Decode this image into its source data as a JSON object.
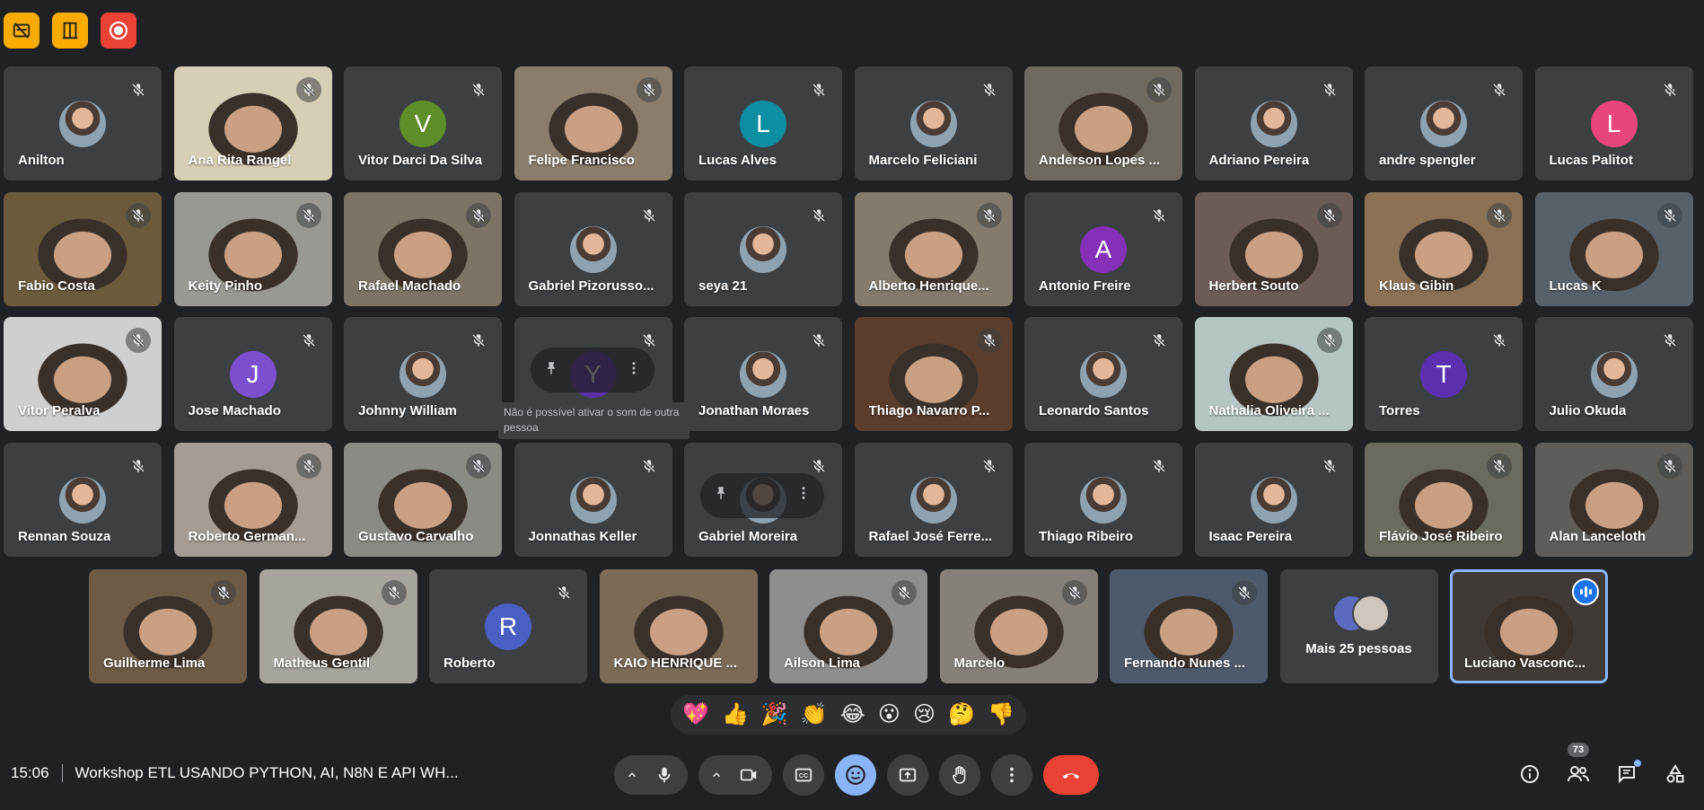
{
  "colors": {
    "background": "#202124",
    "tile": "#3c4043",
    "accent": "#8ab4f8",
    "danger": "#ea4335",
    "warning": "#f9ab00"
  },
  "topbar": [
    {
      "icon": "captions-off-icon"
    },
    {
      "icon": "door-icon"
    },
    {
      "icon": "record-icon"
    }
  ],
  "participants": [
    {
      "name": "Anilton",
      "type": "avatar-photo"
    },
    {
      "name": "Ana Rita Rangel",
      "type": "video",
      "bg": "#d7cfb5"
    },
    {
      "name": "Vitor Darci Da Silva",
      "type": "letter",
      "letter": "V",
      "color": "#5e8d2a"
    },
    {
      "name": "Felipe Francisco",
      "type": "video",
      "bg": "#8b7d6b"
    },
    {
      "name": "Lucas Alves",
      "type": "letter",
      "letter": "L",
      "color": "#0d8ea3"
    },
    {
      "name": "Marcelo Feliciani",
      "type": "avatar-photo"
    },
    {
      "name": "Anderson Lopes ...",
      "type": "video",
      "bg": "#6f6a5f"
    },
    {
      "name": "Adriano Pereira",
      "type": "avatar-photo"
    },
    {
      "name": "andre spengler",
      "type": "avatar-photo"
    },
    {
      "name": "Lucas Palitot",
      "type": "letter",
      "letter": "L",
      "color": "#e8457f"
    },
    {
      "name": "Fabio Costa",
      "type": "video",
      "bg": "#6b5b3c"
    },
    {
      "name": "Keity Pinho",
      "type": "video",
      "bg": "#9a9893"
    },
    {
      "name": "Rafael Machado",
      "type": "video",
      "bg": "#7c7466"
    },
    {
      "name": "Gabriel Pizorusso...",
      "type": "avatar-photo"
    },
    {
      "name": "seya 21",
      "type": "avatar-photo"
    },
    {
      "name": "Alberto Henrique...",
      "type": "video",
      "bg": "#847a6e"
    },
    {
      "name": "Antonio Freire",
      "type": "letter",
      "letter": "A",
      "color": "#8430b7"
    },
    {
      "name": "Herbert Souto",
      "type": "video",
      "bg": "#6c5c58"
    },
    {
      "name": "Klaus Gibin",
      "type": "video",
      "bg": "#8b7155"
    },
    {
      "name": "Lucas K",
      "type": "video",
      "bg": "#58606a"
    },
    {
      "name": "Vitor Peralva",
      "type": "video",
      "bg": "#cfcfcf"
    },
    {
      "name": "Jose Machado",
      "type": "letter",
      "letter": "J",
      "color": "#7b4fcf"
    },
    {
      "name": "Johnny William",
      "type": "avatar-photo"
    },
    {
      "name": "",
      "type": "letter",
      "letter": "Y",
      "color": "#5b2fa6",
      "hover": true
    },
    {
      "name": "Jonathan Moraes",
      "type": "avatar-photo"
    },
    {
      "name": "Thiago Navarro P...",
      "type": "video",
      "bg": "#5a3d2c"
    },
    {
      "name": "Leonardo Santos",
      "type": "avatar-photo"
    },
    {
      "name": "Nathalia Oliveira ...",
      "type": "video",
      "bg": "#b5c5c3"
    },
    {
      "name": "Torres",
      "type": "letter",
      "letter": "T",
      "color": "#5b2fb0"
    },
    {
      "name": "Julio Okuda",
      "type": "avatar-photo"
    },
    {
      "name": "Rennan Souza",
      "type": "avatar-photo"
    },
    {
      "name": "Roberto German...",
      "type": "video",
      "bg": "#a39d95"
    },
    {
      "name": "Gustavo Carvalho",
      "type": "video",
      "bg": "#8b8b86"
    },
    {
      "name": "Jonnathas Keller",
      "type": "avatar-photo"
    },
    {
      "name": "Gabriel Moreira",
      "type": "avatar-photo",
      "hover": true
    },
    {
      "name": "Rafael José Ferre...",
      "type": "avatar-photo"
    },
    {
      "name": "Thiago Ribeiro",
      "type": "avatar-photo"
    },
    {
      "name": "Isaac Pereira",
      "type": "avatar-photo"
    },
    {
      "name": "Flávio José Ribeiro",
      "type": "video",
      "bg": "#6b6a5e"
    },
    {
      "name": "Alan Lanceloth",
      "type": "video",
      "bg": "#5f5d5a"
    }
  ],
  "tooltip": "Não é possível ativar o som de outra pessoa",
  "row5": [
    {
      "name": "Guilherme Lima",
      "type": "video",
      "bg": "#6d5b46"
    },
    {
      "name": "Matheus Gentil",
      "type": "video",
      "bg": "#a7a39d"
    },
    {
      "name": "Roberto",
      "type": "letter",
      "letter": "R",
      "color": "#4a5fc4"
    },
    {
      "name": "KAIO HENRIQUE ...",
      "type": "video",
      "bg": "#7a6a56",
      "nomic": true
    },
    {
      "name": "Ailson Lima",
      "type": "video",
      "bg": "#8e8e8e"
    },
    {
      "name": "Marcelo",
      "type": "video",
      "bg": "#86807a"
    },
    {
      "name": "Fernando Nunes ...",
      "type": "video",
      "bg": "#4e5a6b"
    },
    {
      "name": "",
      "type": "more",
      "label": "Mais 25 pessoas"
    },
    {
      "name": "Luciano Vasconc...",
      "type": "video",
      "bg": "#3f3a35",
      "self": true
    }
  ],
  "reactions": [
    "💖",
    "👍",
    "🎉",
    "👏",
    "😂",
    "😮",
    "😢",
    "🤔",
    "👎"
  ],
  "footer": {
    "time": "15:06",
    "meeting_title": "Workshop ETL USANDO PYTHON, AI, N8N E API WH...",
    "participants_count": "73"
  }
}
